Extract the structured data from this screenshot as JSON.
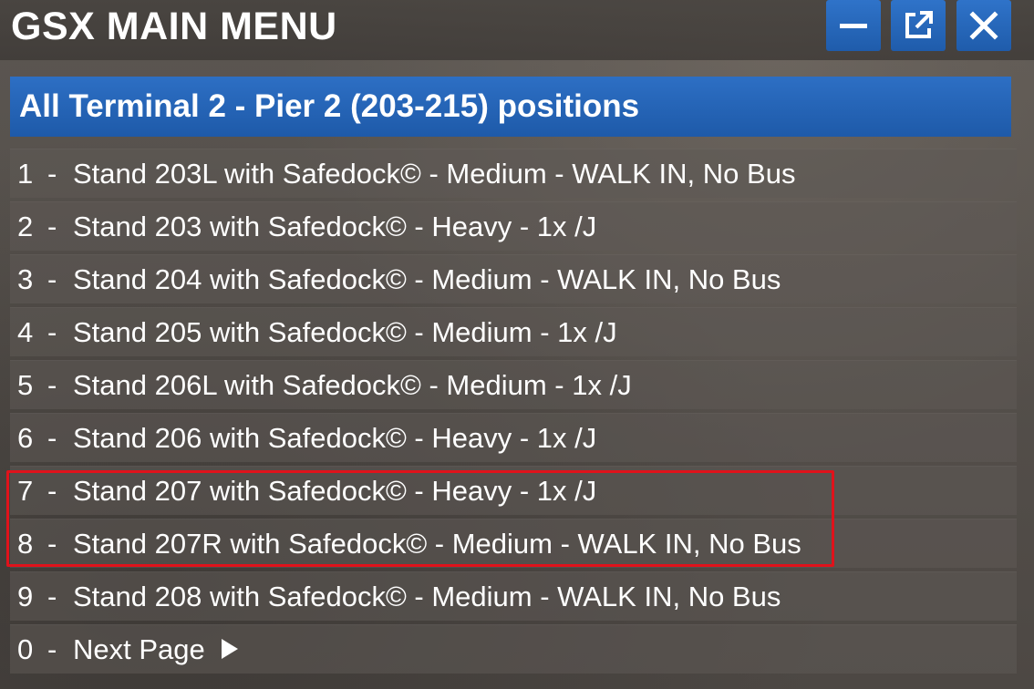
{
  "window": {
    "title": "GSX MAIN MENU",
    "buttons": [
      {
        "icon": "minimize-icon"
      },
      {
        "icon": "popout-icon"
      },
      {
        "icon": "close-icon"
      }
    ],
    "accent_color": "#2466b8",
    "highlight_color": "#e0121b"
  },
  "header": {
    "title": "All Terminal 2 - Pier 2 (203-215) positions"
  },
  "menu": {
    "separator": "-",
    "items": [
      {
        "key": "1",
        "label": "Stand 203L with Safedock© - Medium - WALK IN, No Bus"
      },
      {
        "key": "2",
        "label": "Stand 203 with Safedock© - Heavy - 1x /J"
      },
      {
        "key": "3",
        "label": "Stand 204 with Safedock© - Medium - WALK IN, No Bus"
      },
      {
        "key": "4",
        "label": "Stand 205 with Safedock© - Medium - 1x /J"
      },
      {
        "key": "5",
        "label": "Stand 206L with Safedock© - Medium - 1x /J"
      },
      {
        "key": "6",
        "label": "Stand 206 with Safedock© - Heavy - 1x /J"
      },
      {
        "key": "7",
        "label": "Stand 207 with Safedock© - Heavy - 1x /J"
      },
      {
        "key": "8",
        "label": "Stand 207R with Safedock© - Medium - WALK IN, No Bus"
      },
      {
        "key": "9",
        "label": "Stand 208 with Safedock© - Medium - WALK IN, No Bus"
      },
      {
        "key": "0",
        "label": "Next Page",
        "icon": "play-arrow-icon"
      }
    ]
  }
}
